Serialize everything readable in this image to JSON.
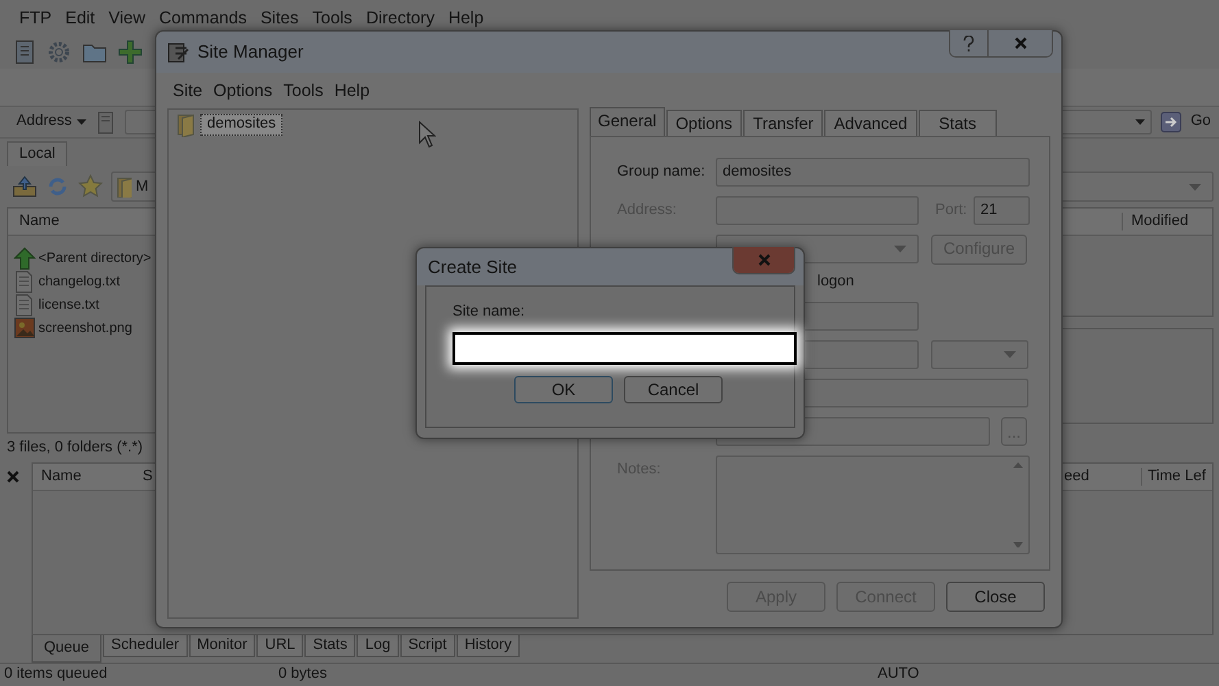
{
  "main_window": {
    "menu": [
      "FTP",
      "Edit",
      "View",
      "Commands",
      "Sites",
      "Tools",
      "Directory",
      "Help"
    ],
    "address_label": "Address",
    "go_label": "Go",
    "local_tab": "Local",
    "path_partial": "M",
    "local_columns": [
      "Name"
    ],
    "local_files": [
      {
        "name": "<Parent directory>",
        "kind": "parent"
      },
      {
        "name": "changelog.txt",
        "kind": "text"
      },
      {
        "name": "license.txt",
        "kind": "text"
      },
      {
        "name": "screenshot.png",
        "kind": "image"
      }
    ],
    "remote_columns": [
      "Modified"
    ],
    "local_status": "3 files, 0 folders (*.*)",
    "queue_columns": [
      "Name",
      "S",
      "eed",
      "Time Lef"
    ],
    "bottom_tabs": [
      {
        "label": "Queue",
        "selected": true
      },
      {
        "label": "Scheduler",
        "selected": false
      },
      {
        "label": "Monitor",
        "selected": false
      },
      {
        "label": "URL",
        "selected": false
      },
      {
        "label": "Stats",
        "selected": false
      },
      {
        "label": "Log",
        "selected": false
      },
      {
        "label": "Script",
        "selected": false
      },
      {
        "label": "History",
        "selected": false
      }
    ],
    "status_bar": [
      "0 items queued",
      "0 bytes",
      "AUTO"
    ]
  },
  "site_manager": {
    "title": "Site Manager",
    "menu": [
      "Site",
      "Options",
      "Tools",
      "Help"
    ],
    "tree": [
      {
        "label": "demosites",
        "selected": true
      }
    ],
    "tabs": [
      {
        "label": "General",
        "selected": true
      },
      {
        "label": "Options",
        "selected": false
      },
      {
        "label": "Transfer",
        "selected": false
      },
      {
        "label": "Advanced",
        "selected": false
      },
      {
        "label": "Stats",
        "selected": false
      }
    ],
    "general": {
      "group_label": "Group name:",
      "group_value": "demosites",
      "address_label": "Address:",
      "address_disabled": true,
      "port_label": "Port:",
      "port_value": "21",
      "configure": "Configure",
      "configure_disabled": true,
      "logon_partial": "logon",
      "browse": "...",
      "notes_label": "Notes:",
      "notes_disabled": true
    },
    "buttons": [
      {
        "label": "Apply",
        "disabled": true
      },
      {
        "label": "Connect",
        "disabled": true
      },
      {
        "label": "Close",
        "disabled": false
      }
    ]
  },
  "create_site": {
    "title": "Create Site",
    "label": "Site name:",
    "buttons": [
      {
        "label": "OK",
        "default": true
      },
      {
        "label": "Cancel",
        "default": false
      }
    ]
  }
}
